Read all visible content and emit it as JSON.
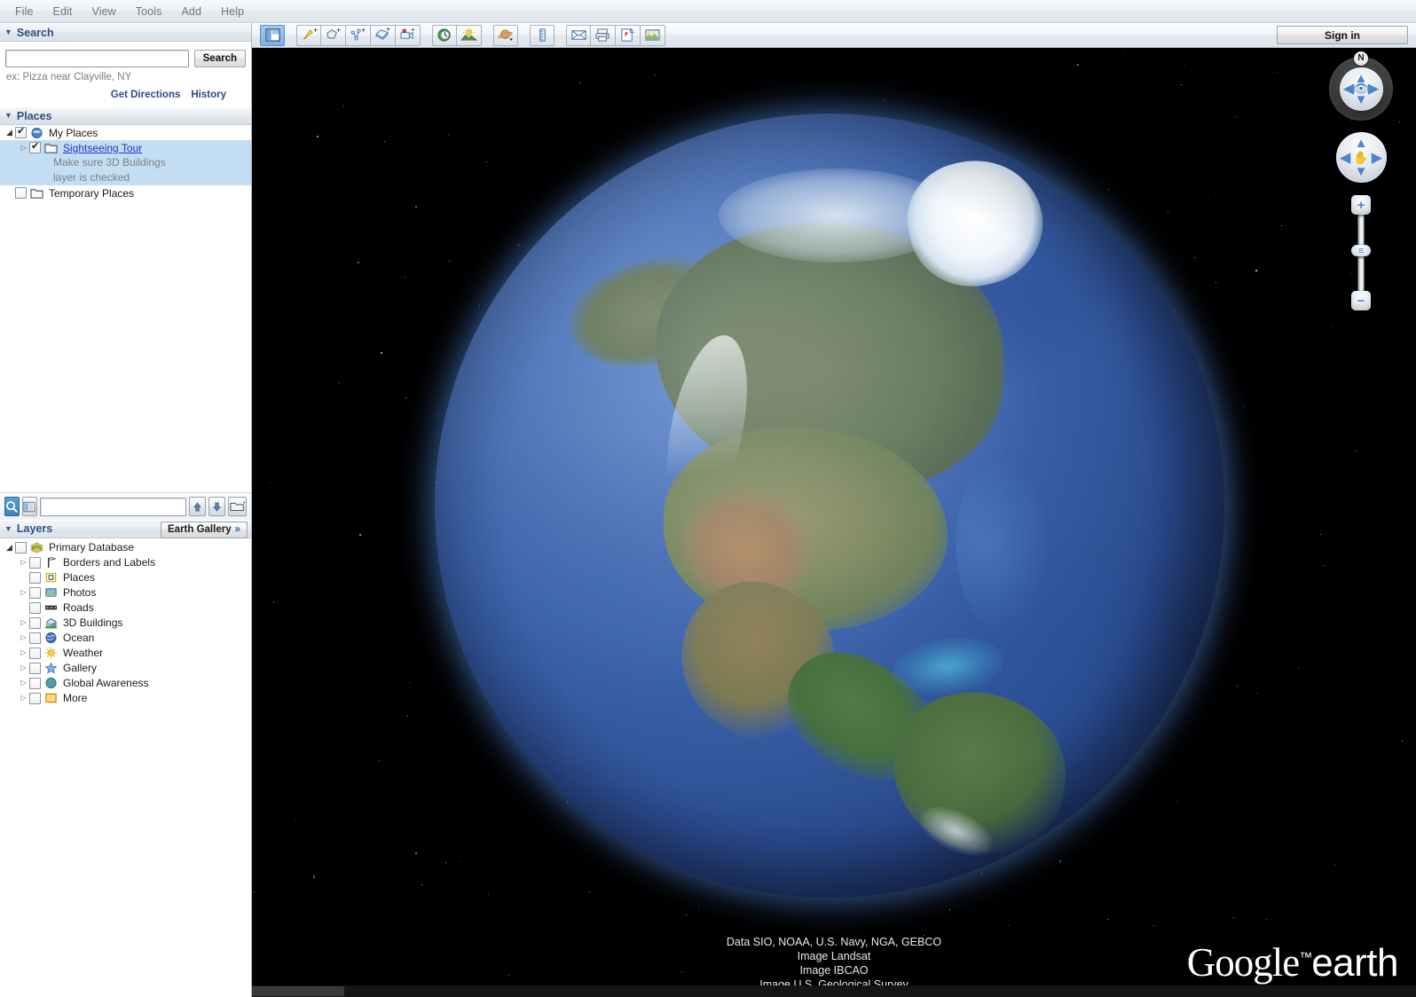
{
  "app": {
    "title": "Google Earth",
    "brand_google": "Google",
    "brand_tm": "™",
    "brand_earth": "earth"
  },
  "menubar": {
    "items": [
      {
        "label": "File",
        "name": "menu-file"
      },
      {
        "label": "Edit",
        "name": "menu-edit"
      },
      {
        "label": "View",
        "name": "menu-view"
      },
      {
        "label": "Tools",
        "name": "menu-tools"
      },
      {
        "label": "Add",
        "name": "menu-add"
      },
      {
        "label": "Help",
        "name": "menu-help"
      }
    ]
  },
  "toolbar": {
    "groups": [
      {
        "buttons": [
          {
            "icon": "sidebar-toggle-icon",
            "name": "toolbar-hide-sidebar",
            "pressed": true
          }
        ]
      },
      {
        "buttons": [
          {
            "icon": "placemark-pin-icon",
            "name": "toolbar-add-placemark",
            "pressed": false
          },
          {
            "icon": "polygon-icon",
            "name": "toolbar-add-polygon",
            "pressed": false
          },
          {
            "icon": "path-icon",
            "name": "toolbar-add-path",
            "pressed": false
          },
          {
            "icon": "image-overlay-icon",
            "name": "toolbar-add-image-overlay",
            "pressed": false
          },
          {
            "icon": "record-tour-icon",
            "name": "toolbar-record-tour",
            "pressed": false
          }
        ]
      },
      {
        "buttons": [
          {
            "icon": "historical-imagery-clock-icon",
            "name": "toolbar-historical-imagery",
            "pressed": false
          },
          {
            "icon": "sunlight-icon",
            "name": "toolbar-sunlight",
            "pressed": false
          }
        ]
      },
      {
        "buttons": [
          {
            "icon": "planet-switch-icon",
            "name": "toolbar-switch-planet",
            "pressed": false
          }
        ]
      },
      {
        "buttons": [
          {
            "icon": "ruler-icon",
            "name": "toolbar-ruler",
            "pressed": false
          }
        ]
      },
      {
        "buttons": [
          {
            "icon": "email-icon",
            "name": "toolbar-email",
            "pressed": false
          },
          {
            "icon": "print-icon",
            "name": "toolbar-print",
            "pressed": false
          },
          {
            "icon": "view-in-maps-icon",
            "name": "toolbar-view-in-google-maps",
            "pressed": false
          },
          {
            "icon": "save-image-icon",
            "name": "toolbar-save-image",
            "pressed": false
          }
        ]
      }
    ],
    "signin_label": "Sign in"
  },
  "search": {
    "panel_title": "Search",
    "input_value": "",
    "input_placeholder": "",
    "button_label": "Search",
    "hint": "ex: Pizza near Clayville, NY",
    "get_directions_label": "Get Directions",
    "history_label": "History"
  },
  "places": {
    "panel_title": "Places",
    "tree": [
      {
        "label": "My Places",
        "checked": true,
        "twisty": "open",
        "icon": "my-places-globe-icon",
        "indent": 0,
        "selected": false,
        "link": false
      },
      {
        "label": "Sightseeing Tour",
        "checked": true,
        "twisty": "closed",
        "icon": "folder-icon",
        "indent": 1,
        "selected": true,
        "link": true
      },
      {
        "label": "Temporary Places",
        "checked": false,
        "twisty": "blank",
        "icon": "folder-icon",
        "indent": 0,
        "selected": false,
        "link": false
      }
    ],
    "description_line1": "Make sure 3D Buildings",
    "description_line2": "layer is checked"
  },
  "filterbar": {
    "search_toggle_icon": "magnifier-icon",
    "view_toggle_icon": "split-view-icon",
    "input_value": "",
    "up_icon": "arrow-up-icon",
    "down_icon": "arrow-down-icon",
    "folder_icon": "folder-dropdown-icon"
  },
  "layers": {
    "panel_title": "Layers",
    "earth_gallery_label": "Earth Gallery",
    "earth_gallery_chevron": "»",
    "tree": [
      {
        "label": "Primary Database",
        "checked": false,
        "twisty": "open",
        "icon": "database-stack-icon",
        "indent": 0
      },
      {
        "label": "Borders and Labels",
        "checked": false,
        "twisty": "closed",
        "icon": "borders-flag-icon",
        "indent": 1
      },
      {
        "label": "Places",
        "checked": false,
        "twisty": "blank",
        "icon": "places-marker-icon",
        "indent": 1
      },
      {
        "label": "Photos",
        "checked": false,
        "twisty": "closed",
        "icon": "photos-icon",
        "indent": 1
      },
      {
        "label": "Roads",
        "checked": false,
        "twisty": "blank",
        "icon": "roads-icon",
        "indent": 1
      },
      {
        "label": "3D Buildings",
        "checked": false,
        "twisty": "closed",
        "icon": "3d-buildings-icon",
        "indent": 1
      },
      {
        "label": "Ocean",
        "checked": false,
        "twisty": "closed",
        "icon": "ocean-globe-icon",
        "indent": 1
      },
      {
        "label": "Weather",
        "checked": false,
        "twisty": "closed",
        "icon": "weather-sun-icon",
        "indent": 1
      },
      {
        "label": "Gallery",
        "checked": false,
        "twisty": "closed",
        "icon": "gallery-star-icon",
        "indent": 1
      },
      {
        "label": "Global Awareness",
        "checked": false,
        "twisty": "closed",
        "icon": "global-awareness-icon",
        "indent": 1
      },
      {
        "label": "More",
        "checked": false,
        "twisty": "closed",
        "icon": "more-folder-icon",
        "indent": 1
      }
    ]
  },
  "navigation": {
    "north_label": "N",
    "look_joystick": {
      "name": "look-joystick",
      "center_icon": "eye-icon"
    },
    "move_joystick": {
      "name": "move-joystick",
      "center_icon": "hand-icon"
    },
    "zoom_in_label": "+",
    "zoom_out_label": "−",
    "zoom_thumb_label": "≡",
    "arrows": {
      "up": "▲",
      "down": "▼",
      "left": "◀",
      "right": "▶"
    }
  },
  "viewport": {
    "attribution": [
      "Data SIO, NOAA, U.S. Navy, NGA, GEBCO",
      "Image Landsat",
      "Image IBCAO",
      "Image U.S. Geological Survey"
    ]
  },
  "colors": {
    "accent_blue": "#2a5fa8",
    "panel_header_text": "#2f5180",
    "selection": "#c3ddf3",
    "link": "#2233cc",
    "space": "#000000",
    "globe_ocean": "#2d4e93",
    "atmosphere": "#7ab4ff"
  }
}
